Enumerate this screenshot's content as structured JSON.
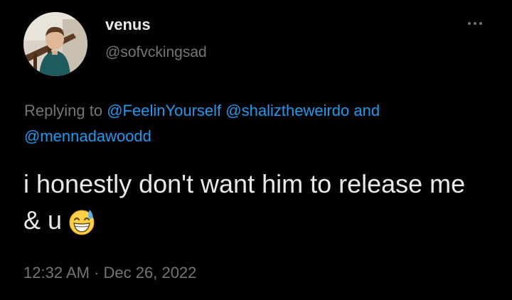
{
  "author": {
    "display_name": "venus",
    "handle": "@sofvckingsad"
  },
  "reply": {
    "prefix": "Replying to",
    "mentions": [
      "@FeelinYourself",
      "@shaliztheweirdo",
      "@mennadawoodd"
    ],
    "conjunction": "and"
  },
  "tweet": {
    "text": "i honestly don't want him to release me & u",
    "emoji": "grinning-face-with-sweat",
    "time": "12:32 AM",
    "separator": "·",
    "date": "Dec 26, 2022"
  },
  "icons": {
    "more": "more-horizontal-icon",
    "avatar": "profile-photo"
  },
  "colors": {
    "background": "#000000",
    "primary_text": "#e7e9ea",
    "secondary_text": "#71767b",
    "link": "#1d9bf0"
  }
}
